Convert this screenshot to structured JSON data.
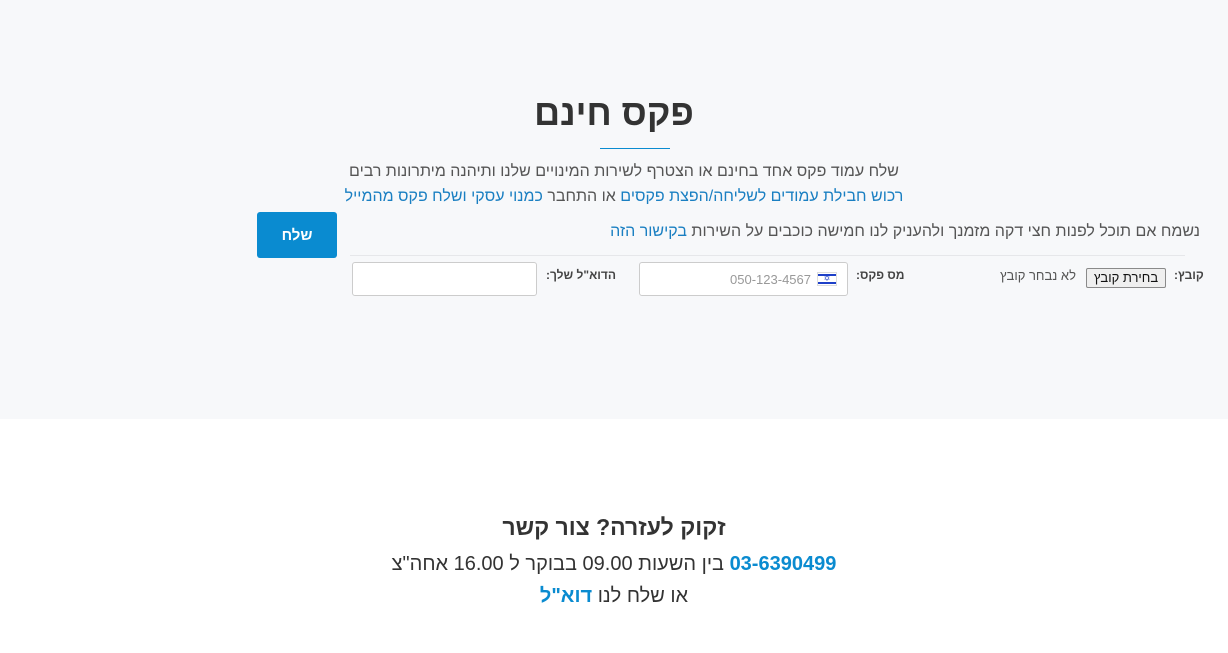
{
  "hero": {
    "title": "פקס חינם",
    "line1": "שלח עמוד פקס אחד בחינם או הצטרף לשירות המינויים שלנו ותיהנה מיתרונות רבים",
    "line2_link1": "רכוש חבילת עמודים לשליחה/הפצת פקסים",
    "line2_mid": " או התחבר ",
    "line2_link2": "כמנוי עסקי ושלח פקס מהמייל",
    "line3_text": "נשמח אם תוכל לפנות חצי דקה מזמנך ולהעניק לנו חמישה כוכבים על השירות ",
    "line3_link": "בקישור הזה"
  },
  "form": {
    "send_label": "שלח",
    "file_label": "קובץ:",
    "file_button": "בחירת קובץ",
    "file_none": "לא נבחר קובץ",
    "fax_label": "מס פקס:",
    "fax_placeholder": "050-123-4567",
    "email_label": "הדוא\"ל שלך:"
  },
  "help": {
    "title": "זקוק לעזרה? צור קשר",
    "phone": "03-6390499",
    "hours": " בין השעות 09.00 בבוקר ל 16.00 אחה\"צ",
    "email_prefix": "או שלח לנו ",
    "email_link": "דוא\"ל"
  },
  "colors": {
    "accent": "#0a8bd0",
    "top_background": "#f7f8fa"
  }
}
